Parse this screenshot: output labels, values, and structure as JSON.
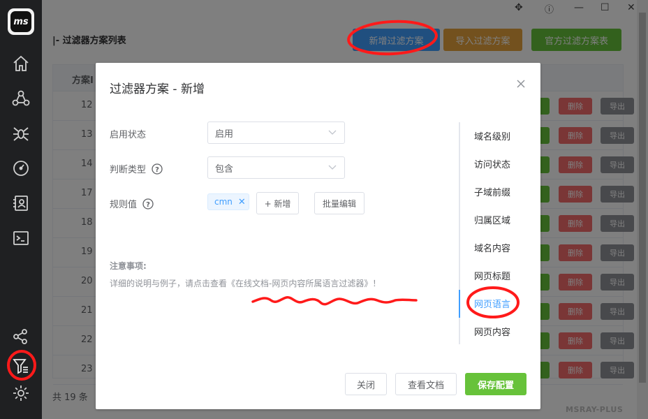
{
  "app": {
    "logo_text": "ms",
    "page_title": "|- 过滤器方案列表",
    "watermark": "MSRAY-PLUS"
  },
  "toolbar": {
    "add_scheme": "新增过滤方案",
    "import_scheme": "导入过滤方案",
    "official_schemes": "官方过滤方案表"
  },
  "table": {
    "header_id": "方案I",
    "rows": [
      {
        "id": "12",
        "delete": "删除",
        "export": "导出"
      },
      {
        "id": "13",
        "delete": "删除",
        "export": "导出"
      },
      {
        "id": "14",
        "delete": "删除",
        "export": "导出"
      },
      {
        "id": "17",
        "delete": "删除",
        "export": "导出"
      },
      {
        "id": "18",
        "delete": "删除",
        "export": "导出"
      },
      {
        "id": "19",
        "delete": "删除",
        "export": "导出"
      },
      {
        "id": "20",
        "delete": "删除",
        "export": "导出"
      },
      {
        "id": "21",
        "delete": "删除",
        "export": "导出"
      },
      {
        "id": "22",
        "delete": "删除",
        "export": "导出"
      },
      {
        "id": "23",
        "delete": "删除",
        "export": "导出"
      }
    ],
    "total": "共 19 条"
  },
  "dialog": {
    "title": "过滤器方案 - 新增",
    "status_label": "启用状态",
    "status_value": "启用",
    "type_label": "判断类型",
    "type_value": "包含",
    "rule_label": "规则值",
    "rule_tag": "cmn",
    "add_button": "+ 新增",
    "batch_edit": "批量编辑",
    "note_title": "注意事项:",
    "note_text": "详细的说明与例子，请点击查看《在线文档-网页内容所属语言过滤器》！",
    "menu": [
      "域名级别",
      "访问状态",
      "子域前缀",
      "归属区域",
      "域名内容",
      "网页标题",
      "网页语言",
      "网页内容"
    ],
    "active_menu_index": 6,
    "close_button": "关闭",
    "docs_button": "查看文档",
    "save_button": "保存配置"
  },
  "colors": {
    "primary": "#409eff",
    "success": "#67c23a",
    "warning": "#e6a23c",
    "danger": "#f56c6c",
    "annotation": "#ff0000"
  }
}
